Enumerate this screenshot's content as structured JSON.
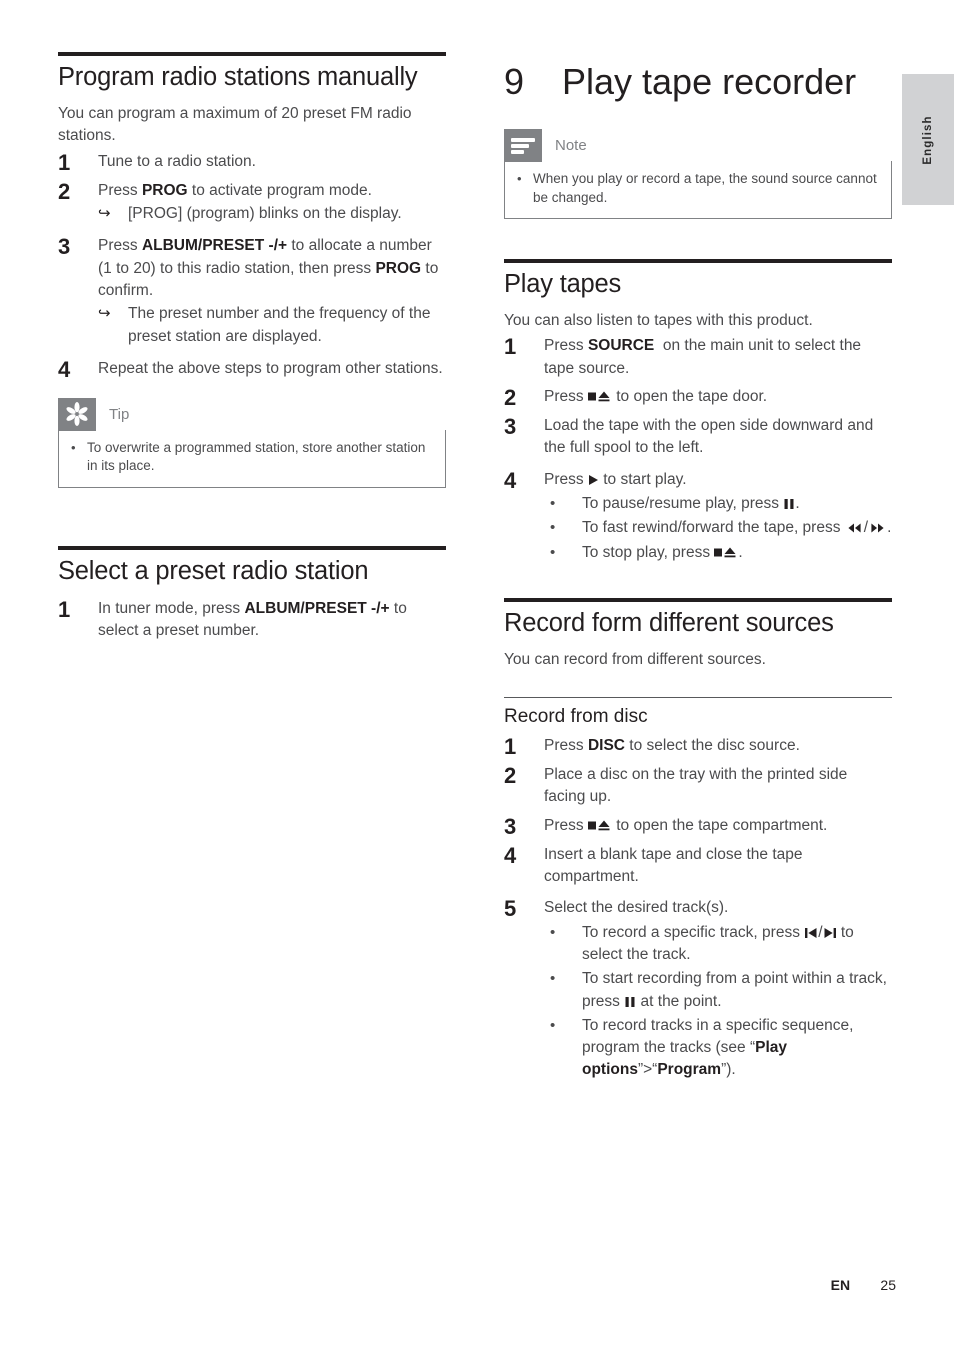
{
  "document": {
    "side_tab_label": "English",
    "footer": {
      "language_code": "EN",
      "page_number": "25"
    },
    "colors": {
      "heading": "#231f20",
      "body_text": "#4b4b4d",
      "callout_gray": "#808285",
      "tab_gray": "#d1d2d4"
    }
  },
  "left_column": {
    "section1": {
      "title": "Program radio stations manually",
      "intro": "You can program a maximum of 20 preset FM radio stations.",
      "steps": [
        {
          "num": "1",
          "text_parts": [
            {
              "t": "Tune to a radio station.",
              "bold": false
            }
          ]
        },
        {
          "num": "2",
          "text_parts": [
            {
              "t": "Press ",
              "bold": false
            },
            {
              "t": "PROG",
              "bold": true
            },
            {
              "t": " to activate program mode.",
              "bold": false
            }
          ],
          "results": [
            "[PROG] (program) blinks on the display."
          ]
        },
        {
          "num": "3",
          "text_parts": [
            {
              "t": "Press ",
              "bold": false
            },
            {
              "t": "ALBUM/PRESET -/+",
              "bold": true
            },
            {
              "t": " to allocate a number (1 to 20) to this radio station, then press ",
              "bold": false
            },
            {
              "t": "PROG",
              "bold": true
            },
            {
              "t": " to confirm.",
              "bold": false
            }
          ],
          "results": [
            "The preset number and the frequency of the preset station are displayed."
          ]
        },
        {
          "num": "4",
          "text_parts": [
            {
              "t": "Repeat the above steps to program other stations.",
              "bold": false
            }
          ]
        }
      ],
      "tip": {
        "icon": "asterisk-icon",
        "label": "Tip",
        "bullets": [
          "To overwrite a programmed station, store another station in its place."
        ]
      }
    },
    "section2": {
      "title": "Select a preset radio station",
      "steps": [
        {
          "num": "1",
          "text_parts": [
            {
              "t": "In tuner mode, press ",
              "bold": false
            },
            {
              "t": "ALBUM/PRESET -/+",
              "bold": true
            },
            {
              "t": " to select a preset number.",
              "bold": false
            }
          ]
        }
      ]
    }
  },
  "right_column": {
    "chapter": {
      "number": "9",
      "title": "Play tape recorder"
    },
    "note": {
      "icon": "note-lines-icon",
      "label": "Note",
      "bullets": [
        "When you play or record a tape, the sound source cannot be changed."
      ]
    },
    "section_play_tapes": {
      "title": "Play tapes",
      "intro": "You can also listen to tapes with this product.",
      "steps": [
        {
          "num": "1",
          "text_parts": [
            {
              "t": "Press ",
              "bold": false
            },
            {
              "t": "SOURCE",
              "bold": true
            },
            {
              "t": "  on the main unit to select the tape source.",
              "bold": false
            }
          ]
        },
        {
          "num": "2",
          "text_parts": [
            {
              "t": "Press ",
              "bold": false
            },
            {
              "t": "[stop-eject-icon]",
              "bold": false,
              "glyph": "stop-eject"
            },
            {
              "t": " to open the tape door.",
              "bold": false
            }
          ]
        },
        {
          "num": "3",
          "text_parts": [
            {
              "t": "Load the tape with the open side downward and the full spool to the left.",
              "bold": false
            }
          ]
        },
        {
          "num": "4",
          "text_parts": [
            {
              "t": "Press ",
              "bold": false
            },
            {
              "t": "[play-icon]",
              "bold": false,
              "glyph": "play"
            },
            {
              "t": " to start play.",
              "bold": false
            }
          ],
          "bullets": [
            {
              "parts": [
                {
                  "t": "To pause/resume play, press ",
                  "glyph": null
                },
                {
                  "t": "[pause-icon]",
                  "glyph": "pause"
                },
                {
                  "t": ".",
                  "glyph": null
                }
              ]
            },
            {
              "parts": [
                {
                  "t": "To fast rewind/forward the tape, press ",
                  "glyph": null
                },
                {
                  "t": "[rewind-icon]",
                  "glyph": "rewind"
                },
                {
                  "t": "/",
                  "glyph": null
                },
                {
                  "t": "[forward-icon]",
                  "glyph": "forward"
                },
                {
                  "t": ".",
                  "glyph": null
                }
              ]
            },
            {
              "parts": [
                {
                  "t": "To stop play, press ",
                  "glyph": null
                },
                {
                  "t": "[stop-eject-icon]",
                  "glyph": "stop-eject"
                },
                {
                  "t": ".",
                  "glyph": null
                }
              ]
            }
          ]
        }
      ]
    },
    "section_record": {
      "title": "Record form different sources",
      "intro": "You can record from different sources.",
      "subsection": {
        "title": "Record from disc",
        "steps": [
          {
            "num": "1",
            "text_parts": [
              {
                "t": "Press ",
                "bold": false
              },
              {
                "t": "DISC",
                "bold": true
              },
              {
                "t": " to select the disc source.",
                "bold": false
              }
            ]
          },
          {
            "num": "2",
            "text_parts": [
              {
                "t": "Place a disc on the tray with the printed side facing up.",
                "bold": false
              }
            ]
          },
          {
            "num": "3",
            "text_parts": [
              {
                "t": "Press ",
                "bold": false
              },
              {
                "t": "[stop-eject-icon]",
                "bold": false,
                "glyph": "stop-eject"
              },
              {
                "t": " to open the tape compartment.",
                "bold": false
              }
            ]
          },
          {
            "num": "4",
            "text_parts": [
              {
                "t": "Insert a blank tape and close the tape compartment.",
                "bold": false
              }
            ]
          },
          {
            "num": "5",
            "text_parts": [
              {
                "t": "Select the desired track(s).",
                "bold": false
              }
            ],
            "bullets": [
              {
                "parts": [
                  {
                    "t": "To record a specific track, press ",
                    "glyph": null
                  },
                  {
                    "t": "[prev-track-icon]",
                    "glyph": "prev"
                  },
                  {
                    "t": "/",
                    "glyph": null
                  },
                  {
                    "t": "[next-track-icon]",
                    "glyph": "next"
                  },
                  {
                    "t": " to select the track.",
                    "glyph": null
                  }
                ]
              },
              {
                "parts": [
                  {
                    "t": "To start recording from a point within a track, press ",
                    "glyph": null
                  },
                  {
                    "t": "[pause-icon]",
                    "glyph": "pause"
                  },
                  {
                    "t": " at the point.",
                    "glyph": null
                  }
                ]
              },
              {
                "parts": [
                  {
                    "t": "To record tracks in a specific sequence, program the tracks (see “",
                    "glyph": null
                  },
                  {
                    "t": "Play options",
                    "glyph": null,
                    "bold": true
                  },
                  {
                    "t": "”>“",
                    "glyph": null
                  },
                  {
                    "t": "Program",
                    "glyph": null,
                    "bold": true
                  },
                  {
                    "t": "”).",
                    "glyph": null
                  }
                ]
              }
            ]
          }
        ]
      }
    }
  }
}
